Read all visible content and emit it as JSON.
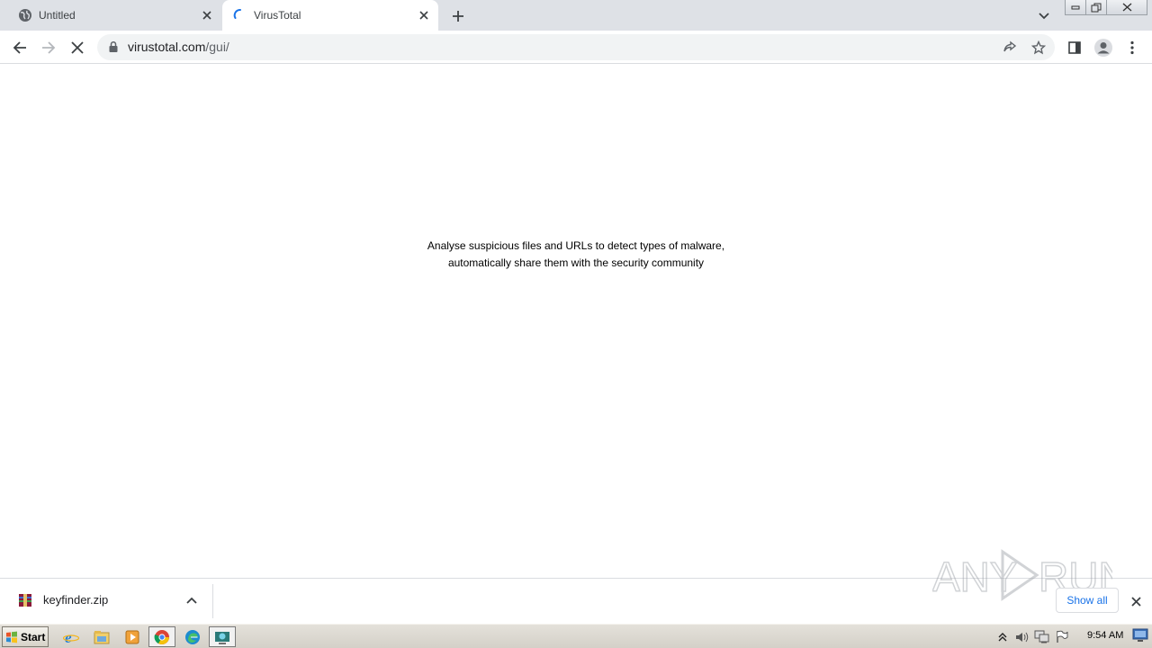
{
  "tabs": [
    {
      "title": "Untitled",
      "favicon": "globe-icon",
      "active": false
    },
    {
      "title": "VirusTotal",
      "favicon": "loading-spinner-icon",
      "active": true
    }
  ],
  "toolbar": {
    "url_host": "virustotal.com",
    "url_path": "/gui/"
  },
  "page": {
    "tagline_line1": "Analyse suspicious files and URLs to detect types of malware,",
    "tagline_line2": "automatically share them with the security community"
  },
  "downloads": {
    "filename": "keyfinder.zip",
    "show_all_label": "Show all",
    "watermark": "ANY RUN"
  },
  "taskbar": {
    "start_label": "Start",
    "clock": "9:54 AM",
    "apps": [
      "internet-explorer-icon",
      "file-explorer-icon",
      "media-player-icon",
      "chrome-icon",
      "edge-icon",
      "network-tool-icon"
    ]
  },
  "colors": {
    "tabstrip": "#dee1e6",
    "accent_blue": "#1a73e8",
    "omnibox": "#f1f3f4"
  }
}
